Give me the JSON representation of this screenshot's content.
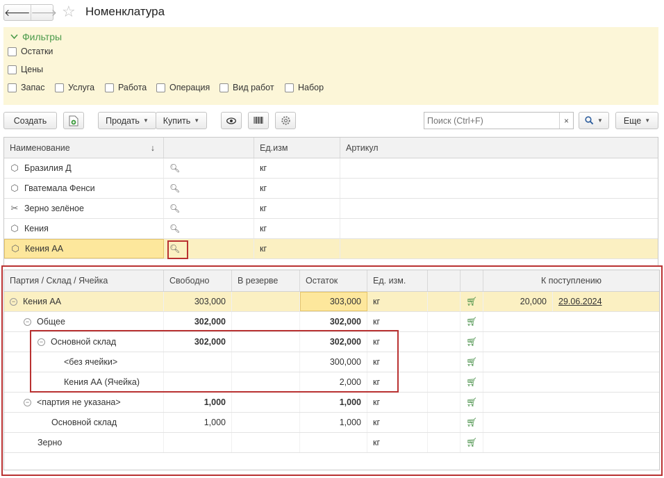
{
  "window": {
    "title": "Номенклатура",
    "back_glyph": "🡐",
    "forward_glyph": "🡒",
    "star_glyph": "☆"
  },
  "filters": {
    "title": "Фильтры",
    "items": [
      "Остатки",
      "Цены",
      "Запас",
      "Услуга",
      "Работа",
      "Операция",
      "Вид работ",
      "Набор"
    ]
  },
  "toolbar": {
    "create": "Создать",
    "sell": "Продать",
    "buy": "Купить",
    "search_placeholder": "Поиск (Ctrl+F)",
    "clear": "×",
    "more": "Еще"
  },
  "items_table": {
    "columns": [
      "Наименование",
      "",
      "Ед.изм",
      "Артикул"
    ],
    "sort_glyph": "↓",
    "rows": [
      {
        "name": "Бразилия Д",
        "icon": "box-icon",
        "unit": "кг",
        "article": ""
      },
      {
        "name": "Гватемала Фенси",
        "icon": "box-icon",
        "unit": "кг",
        "article": ""
      },
      {
        "name": "Зерно зелёное",
        "icon": "tools-icon",
        "unit": "кг",
        "article": ""
      },
      {
        "name": "Кения",
        "icon": "box-icon",
        "unit": "кг",
        "article": ""
      },
      {
        "name": "Кения АА",
        "icon": "box-icon",
        "unit": "кг",
        "article": "",
        "selected": true
      }
    ]
  },
  "stock_table": {
    "columns": [
      "Партия / Склад / Ячейка",
      "Свободно",
      "В резерве",
      "Остаток",
      "Ед. изм.",
      "",
      "",
      "К поступлению"
    ],
    "rows": [
      {
        "name": "Кения АА",
        "level": 0,
        "collapse": true,
        "free": "303,000",
        "reserve": "",
        "balance": "303,000",
        "unit": "кг",
        "incoming_qty": "20,000",
        "incoming_date": "29.06.2024",
        "selected": true
      },
      {
        "name": "Общее",
        "level": 1,
        "collapse": true,
        "free": "302,000",
        "reserve": "",
        "balance": "302,000",
        "unit": "кг",
        "bold": true
      },
      {
        "name": "Основной склад",
        "level": 2,
        "collapse": true,
        "free": "302,000",
        "reserve": "",
        "balance": "302,000",
        "unit": "кг",
        "bold": true
      },
      {
        "name": "<без ячейки>",
        "level": 4,
        "free": "",
        "reserve": "",
        "balance": "300,000",
        "unit": "кг"
      },
      {
        "name": "Кения АА (Ячейка)",
        "level": 4,
        "free": "",
        "reserve": "",
        "balance": "2,000",
        "unit": "кг"
      },
      {
        "name": "<партия не указана>",
        "level": 1,
        "collapse": true,
        "free": "1,000",
        "reserve": "",
        "balance": "1,000",
        "unit": "кг",
        "bold": true
      },
      {
        "name": "Основной склад",
        "level": 3,
        "free": "1,000",
        "reserve": "",
        "balance": "1,000",
        "unit": "кг"
      },
      {
        "name": "Зерно",
        "level": 1,
        "free": "",
        "reserve": "",
        "balance": "",
        "unit": "кг"
      }
    ]
  },
  "colors": {
    "highlight": "#fde79c",
    "selection": "#fbf0c2",
    "filters_bg": "#fcf6d8",
    "accent_red": "#b93131",
    "filters_green": "#4a9a4a"
  }
}
